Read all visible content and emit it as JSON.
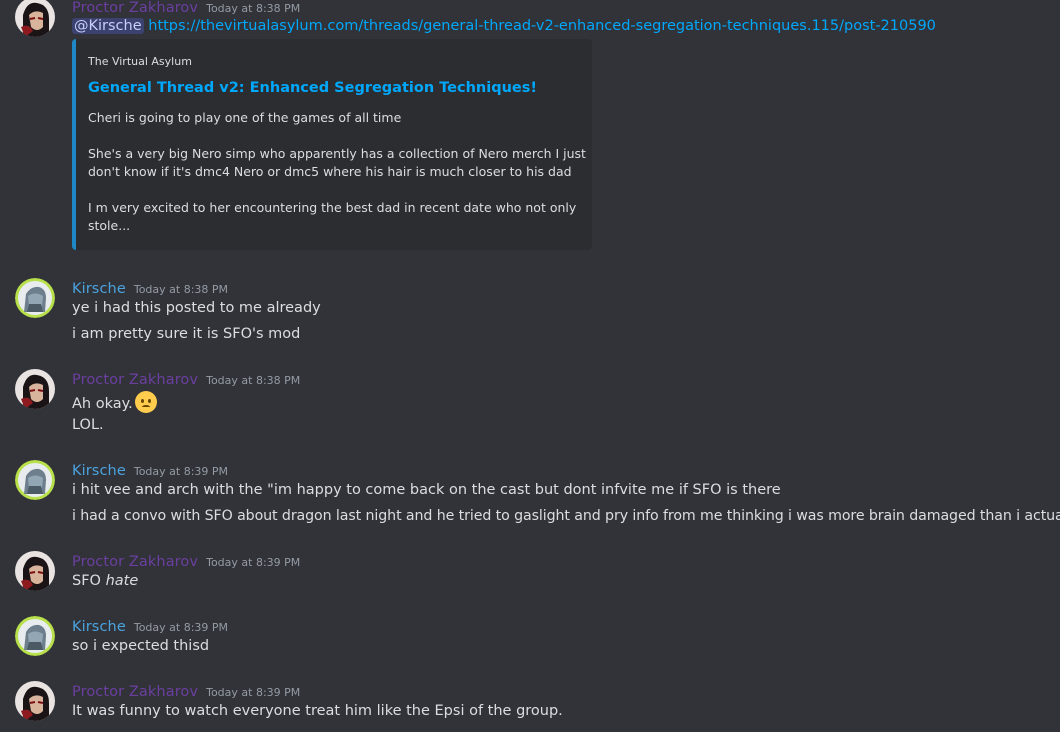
{
  "users": {
    "proctor": {
      "name": "Proctor Zakharov",
      "color": "#6b3fa0"
    },
    "kirsche": {
      "name": "Kirsche",
      "color": "#4aa3df"
    }
  },
  "messages": [
    {
      "id": "m1",
      "author": "Proctor Zakharov",
      "timestamp": "Today at 8:38 PM",
      "mention": "@Kirsche",
      "link": "https://thevirtualasylum.com/threads/general-thread-v2-enhanced-segregation-techniques.115/post-210590",
      "embed": {
        "provider": "The Virtual Asylum",
        "title": "General Thread v2: Enhanced Segregation Techniques!",
        "lines": [
          "Cheri is going to play one of the games of all time",
          "She's a very big Nero simp who apparently has a collection of Nero merch I just",
          "don't know if it's dmc4 Nero or dmc5 where his hair is much closer to his dad",
          "I m very excited to her encountering the best dad in recent date who not only",
          "stole..."
        ]
      }
    },
    {
      "id": "m2",
      "author": "Kirsche",
      "timestamp": "Today at 8:38 PM",
      "lines": [
        "ye i had this posted to me already",
        "i am pretty sure it is SFO's mod"
      ]
    },
    {
      "id": "m3",
      "author": "Proctor Zakharov",
      "timestamp": "Today at 8:38 PM",
      "lines": [
        "Ah okay.",
        "LOL."
      ],
      "emoji": "frowning-face-emoji"
    },
    {
      "id": "m4",
      "author": "Kirsche",
      "timestamp": "Today at 8:39 PM",
      "lines": [
        "i hit vee and arch with the \"im happy to come back on the cast but dont infvite me if SFO is there",
        "i had a convo with SFO about dragon last night and he tried to gaslight and pry info from me thinking i was more brain damaged than i actually am"
      ]
    },
    {
      "id": "m5",
      "author": "Proctor Zakharov",
      "timestamp": "Today at 8:39 PM",
      "text_plain": "SFO",
      "text_italic": "hate"
    },
    {
      "id": "m6",
      "author": "Kirsche",
      "timestamp": "Today at 8:39 PM",
      "lines": [
        "so i expected thisd"
      ]
    },
    {
      "id": "m7",
      "author": "Proctor Zakharov",
      "timestamp": "Today at 8:39 PM",
      "lines": [
        "It was funny to watch everyone treat him like the Epsi of the group."
      ]
    }
  ]
}
